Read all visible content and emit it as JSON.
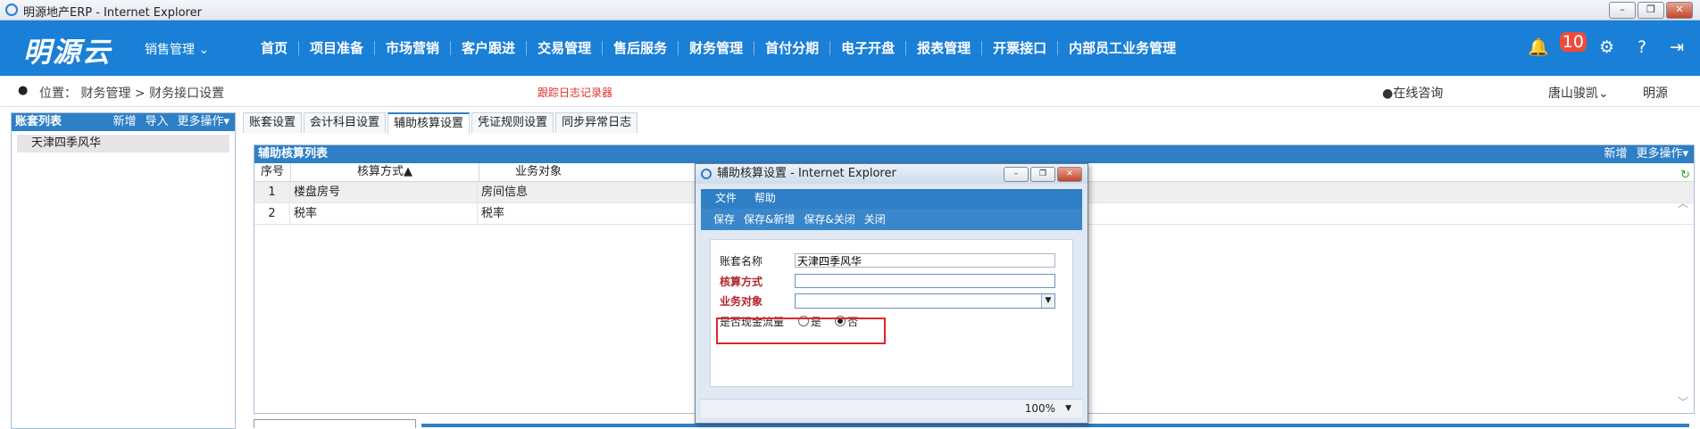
{
  "browser": {
    "title": "明源地产ERP - Internet Explorer",
    "min": "–",
    "restore": "❐",
    "close": "✕"
  },
  "header": {
    "logo": "明源云",
    "sales_menu": "销售管理 ⌄",
    "nav": [
      "首页",
      "项目准备",
      "市场营销",
      "客户跟进",
      "交易管理",
      "售后服务",
      "财务管理",
      "首付分期",
      "电子开盘",
      "报表管理",
      "开票接口",
      "内部员工业务管理"
    ],
    "notif_badge": "10",
    "icons": {
      "bell": "🔔",
      "gear": "⚙",
      "help": "?",
      "logout": "⇥"
    }
  },
  "breadcrumb": {
    "pin": "●",
    "text": "位置：  财务管理 > 财务接口设置",
    "trace": "跟踪日志记录器",
    "consult": "●在线咨询",
    "org": "唐山骏凯⌄",
    "user": "明源"
  },
  "left": {
    "title": "账套列表",
    "actions": [
      "新增",
      "导入",
      "更多操作▾"
    ],
    "items": [
      "天津四季风华"
    ]
  },
  "tabs": [
    "账套设置",
    "会计科目设置",
    "辅助核算设置",
    "凭证规则设置",
    "同步异常日志"
  ],
  "grid": {
    "title": "辅助核算列表",
    "actions": [
      "新增",
      "更多操作▾"
    ],
    "columns": [
      "序号",
      "核算方式▲",
      "业务对象"
    ],
    "rows": [
      {
        "idx": "1",
        "method": "楼盘房号",
        "object": "房间信息"
      },
      {
        "idx": "2",
        "method": "税率",
        "object": "税率"
      }
    ],
    "refresh": "↻",
    "up": "︿",
    "down": "﹀"
  },
  "dialog": {
    "title": "辅助核算设置 - Internet Explorer",
    "menu": [
      "文件",
      "帮助"
    ],
    "toolbar": [
      "保存",
      "保存&新增",
      "保存&关闭",
      "关闭"
    ],
    "fields": {
      "set_name_label": "账套名称",
      "set_name_value": "天津四季风华",
      "method_label": "核算方式",
      "object_label": "业务对象",
      "cashflow_label": "是否现金流量",
      "yes": "是",
      "no": "否"
    },
    "zoom": "100%",
    "zoom_arrow": "▼"
  }
}
